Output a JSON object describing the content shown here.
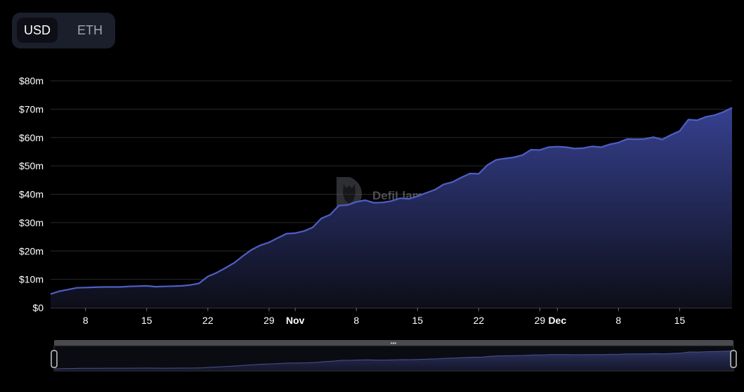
{
  "currency_toggle": {
    "options": [
      "USD",
      "ETH"
    ],
    "selected": "USD"
  },
  "watermark": {
    "text": "DefiLlama"
  },
  "colors": {
    "background": "#000000",
    "line": "#4f5fc4",
    "area_top": "#36408f",
    "area_bottom": "#0d0e18",
    "grid": "#2a2a2e",
    "label": "#ffffff"
  },
  "chart_data": {
    "type": "area",
    "x_start": "2024-10-04",
    "x_end": "2024-12-21",
    "ylim": [
      0,
      80
    ],
    "y_ticks": [
      "$0",
      "$10m",
      "$20m",
      "$30m",
      "$40m",
      "$50m",
      "$60m",
      "$70m",
      "$80m"
    ],
    "x_ticks": [
      {
        "date": "2024-10-08",
        "label": "8",
        "bold": false
      },
      {
        "date": "2024-10-15",
        "label": "15",
        "bold": false
      },
      {
        "date": "2024-10-22",
        "label": "22",
        "bold": false
      },
      {
        "date": "2024-10-29",
        "label": "29",
        "bold": false
      },
      {
        "date": "2024-11-01",
        "label": "Nov",
        "bold": true
      },
      {
        "date": "2024-11-08",
        "label": "8",
        "bold": false
      },
      {
        "date": "2024-11-15",
        "label": "15",
        "bold": false
      },
      {
        "date": "2024-11-22",
        "label": "22",
        "bold": false
      },
      {
        "date": "2024-11-29",
        "label": "29",
        "bold": false
      },
      {
        "date": "2024-12-01",
        "label": "Dec",
        "bold": true
      },
      {
        "date": "2024-12-08",
        "label": "8",
        "bold": false
      },
      {
        "date": "2024-12-15",
        "label": "15",
        "bold": false
      }
    ],
    "grid": true,
    "series": [
      {
        "unit": "USD millions",
        "points": [
          [
            "2024-10-04",
            4.8
          ],
          [
            "2024-10-05",
            5.8
          ],
          [
            "2024-10-06",
            6.4
          ],
          [
            "2024-10-07",
            7.0
          ],
          [
            "2024-10-08",
            7.1
          ],
          [
            "2024-10-09",
            7.2
          ],
          [
            "2024-10-10",
            7.3
          ],
          [
            "2024-10-11",
            7.3
          ],
          [
            "2024-10-12",
            7.3
          ],
          [
            "2024-10-13",
            7.5
          ],
          [
            "2024-10-14",
            7.6
          ],
          [
            "2024-10-15",
            7.7
          ],
          [
            "2024-10-16",
            7.4
          ],
          [
            "2024-10-17",
            7.5
          ],
          [
            "2024-10-18",
            7.6
          ],
          [
            "2024-10-19",
            7.7
          ],
          [
            "2024-10-20",
            8.0
          ],
          [
            "2024-10-21",
            8.6
          ],
          [
            "2024-10-22",
            11.0
          ],
          [
            "2024-10-23",
            12.3
          ],
          [
            "2024-10-24",
            14.0
          ],
          [
            "2024-10-25",
            15.8
          ],
          [
            "2024-10-26",
            18.2
          ],
          [
            "2024-10-27",
            20.4
          ],
          [
            "2024-10-28",
            22.0
          ],
          [
            "2024-10-29",
            23.0
          ],
          [
            "2024-10-30",
            24.6
          ],
          [
            "2024-10-31",
            26.1
          ],
          [
            "2024-11-01",
            26.3
          ],
          [
            "2024-11-02",
            27.0
          ],
          [
            "2024-11-03",
            28.3
          ],
          [
            "2024-11-04",
            31.5
          ],
          [
            "2024-11-05",
            32.8
          ],
          [
            "2024-11-06",
            36.0
          ],
          [
            "2024-11-07",
            36.2
          ],
          [
            "2024-11-08",
            37.3
          ],
          [
            "2024-11-09",
            37.9
          ],
          [
            "2024-11-10",
            37.0
          ],
          [
            "2024-11-11",
            37.1
          ],
          [
            "2024-11-12",
            37.6
          ],
          [
            "2024-11-13",
            38.6
          ],
          [
            "2024-11-14",
            38.4
          ],
          [
            "2024-11-15",
            39.3
          ],
          [
            "2024-11-16",
            40.5
          ],
          [
            "2024-11-17",
            41.6
          ],
          [
            "2024-11-18",
            43.5
          ],
          [
            "2024-11-19",
            44.3
          ],
          [
            "2024-11-20",
            45.9
          ],
          [
            "2024-11-21",
            47.3
          ],
          [
            "2024-11-22",
            47.2
          ],
          [
            "2024-11-23",
            50.3
          ],
          [
            "2024-11-24",
            52.1
          ],
          [
            "2024-11-25",
            52.6
          ],
          [
            "2024-11-26",
            53.0
          ],
          [
            "2024-11-27",
            53.8
          ],
          [
            "2024-11-28",
            55.7
          ],
          [
            "2024-11-29",
            55.6
          ],
          [
            "2024-11-30",
            56.6
          ],
          [
            "2024-12-01",
            56.8
          ],
          [
            "2024-12-02",
            56.6
          ],
          [
            "2024-12-03",
            56.1
          ],
          [
            "2024-12-04",
            56.3
          ],
          [
            "2024-12-05",
            56.9
          ],
          [
            "2024-12-06",
            56.6
          ],
          [
            "2024-12-07",
            57.6
          ],
          [
            "2024-12-08",
            58.2
          ],
          [
            "2024-12-09",
            59.5
          ],
          [
            "2024-12-10",
            59.4
          ],
          [
            "2024-12-11",
            59.5
          ],
          [
            "2024-12-12",
            60.1
          ],
          [
            "2024-12-13",
            59.3
          ],
          [
            "2024-12-14",
            60.9
          ],
          [
            "2024-12-15",
            62.3
          ],
          [
            "2024-12-16",
            66.3
          ],
          [
            "2024-12-17",
            66.1
          ],
          [
            "2024-12-18",
            67.3
          ],
          [
            "2024-12-19",
            67.9
          ],
          [
            "2024-12-20",
            69.0
          ],
          [
            "2024-12-21",
            70.5
          ]
        ]
      }
    ],
    "range_selector": {
      "start_fraction": 0.0,
      "end_fraction": 1.0
    }
  }
}
